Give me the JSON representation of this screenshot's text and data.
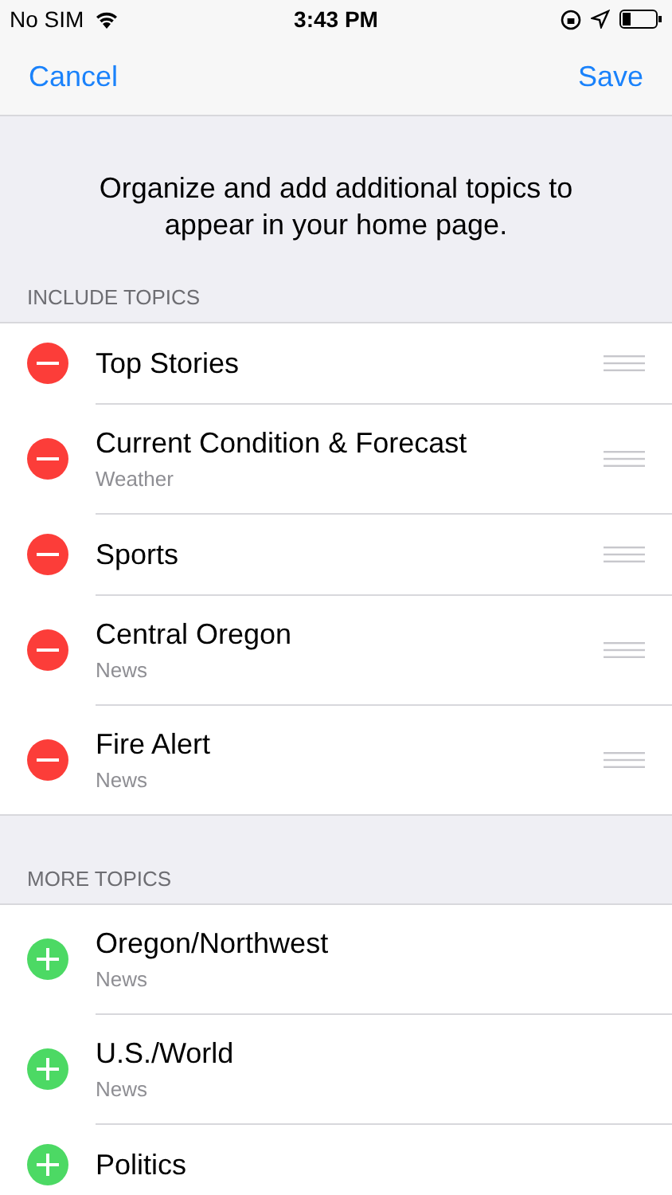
{
  "status_bar": {
    "carrier": "No SIM",
    "time": "3:43 PM"
  },
  "nav": {
    "cancel": "Cancel",
    "save": "Save"
  },
  "intro": "Organize and add additional topics to appear in your home page.",
  "sections": [
    {
      "title": "INCLUDE TOPICS",
      "kind": "remove",
      "items": [
        {
          "title": "Top Stories"
        },
        {
          "title": "Current Condition & Forecast",
          "subtitle": "Weather"
        },
        {
          "title": "Sports"
        },
        {
          "title": "Central Oregon",
          "subtitle": "News"
        },
        {
          "title": "Fire Alert",
          "subtitle": "News"
        }
      ]
    },
    {
      "title": "MORE TOPICS",
      "kind": "add",
      "items": [
        {
          "title": "Oregon/Northwest",
          "subtitle": "News"
        },
        {
          "title": "U.S./World",
          "subtitle": "News"
        },
        {
          "title": "Politics"
        }
      ]
    }
  ]
}
